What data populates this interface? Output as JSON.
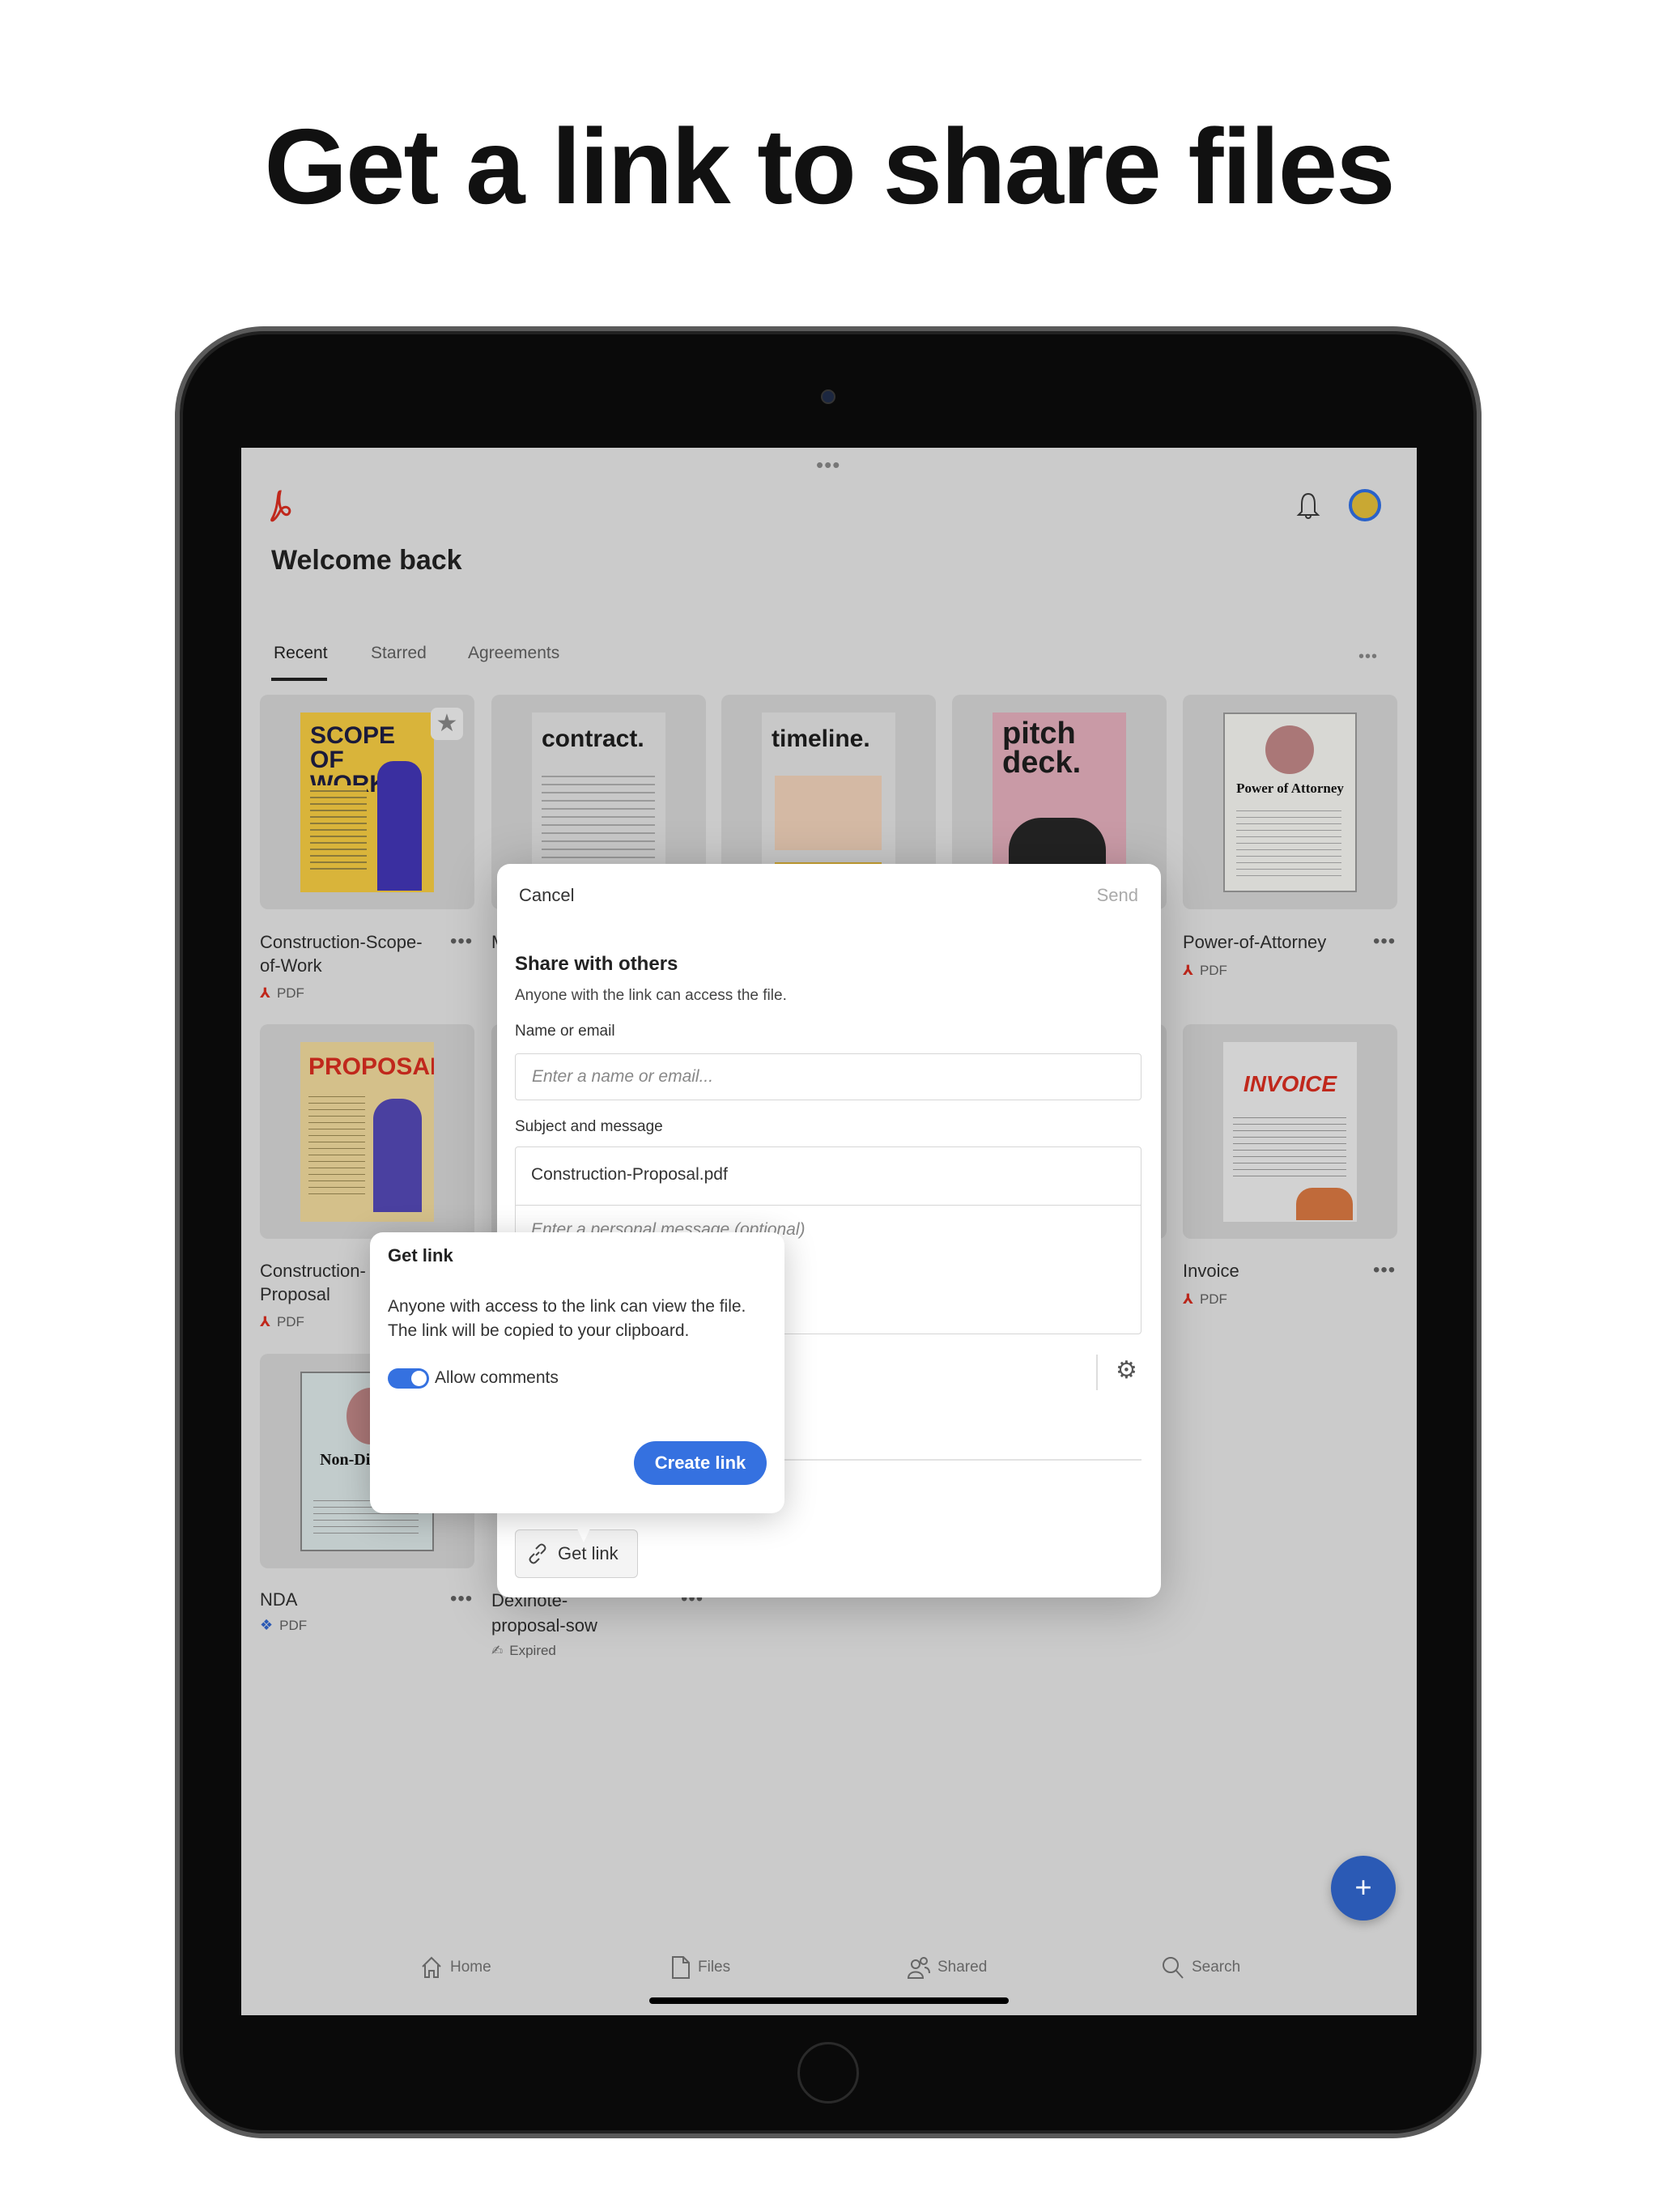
{
  "headline": "Get a link to share files",
  "app": {
    "welcome": "Welcome back",
    "tabs": [
      {
        "label": "Recent",
        "active": true
      },
      {
        "label": "Starred"
      },
      {
        "label": "Agreements"
      }
    ],
    "more": "•••",
    "cards": [
      {
        "title": "Construction-Scope-\nof-Work",
        "type": "PDF",
        "thumb": "SCOPE OF WORK",
        "starred": true
      },
      {
        "title": "M",
        "type": "",
        "thumb": "contract."
      },
      {
        "title": "",
        "type": "",
        "thumb": "timeline."
      },
      {
        "title": "",
        "type": "",
        "thumb": "pitch deck."
      },
      {
        "title": "Power-of-Attorney",
        "type": "PDF",
        "thumb": "Power of Attorney"
      },
      {
        "title": "Construction-\nProposal",
        "type": "PDF",
        "thumb": "PROPOSAL"
      },
      {
        "title": "Invoice",
        "type": "PDF",
        "thumb": "INVOICE"
      },
      {
        "title": "NDA",
        "type": "PDF",
        "thumb": "Non-Di Agree",
        "source": "dropbox"
      },
      {
        "title": "Dexinote-\nproposal-sow",
        "type": "Expired",
        "source": "signature"
      }
    ],
    "nav": [
      {
        "label": "Home",
        "icon": "home-icon"
      },
      {
        "label": "Files",
        "icon": "file-icon"
      },
      {
        "label": "Shared",
        "icon": "people-icon"
      },
      {
        "label": "Search",
        "icon": "search-icon"
      }
    ],
    "colors": {
      "accent": "#3571e0",
      "fab": "#2b5ab5",
      "pdf": "#c0281c"
    }
  },
  "share": {
    "cancel": "Cancel",
    "send": "Send",
    "title": "Share with others",
    "subtitle": "Anyone with the link can access the file.",
    "name_label": "Name or email",
    "name_placeholder": "Enter a name or email...",
    "subject_label": "Subject and message",
    "subject_value": "Construction-Proposal.pdf",
    "message_placeholder": "Enter a personal message (optional)",
    "get_link": "Get link"
  },
  "popover": {
    "title": "Get link",
    "line1": "Anyone with access to the link can view the file.",
    "line2": "The link will be copied to your clipboard.",
    "toggle_label": "Allow comments",
    "toggle_on": true,
    "create": "Create link"
  }
}
